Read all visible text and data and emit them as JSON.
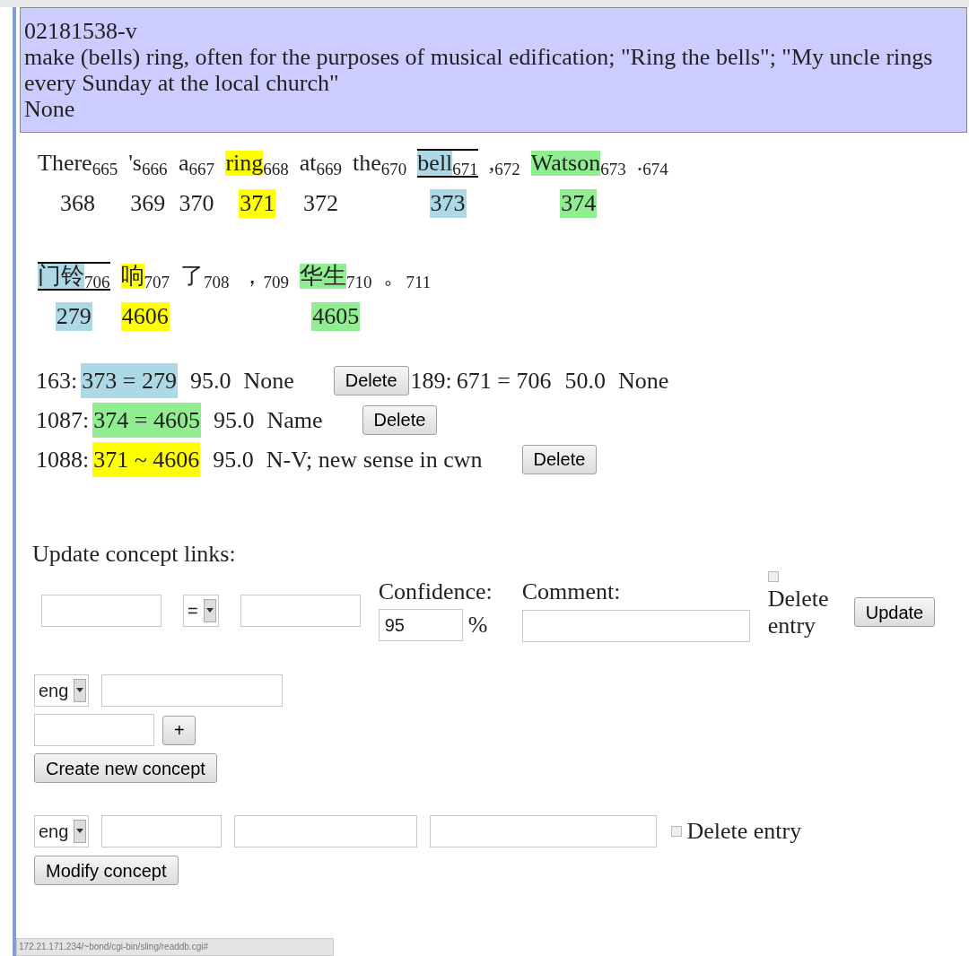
{
  "header": {
    "id": "02181538-v",
    "definition": "make (bells) ring, often for the purposes of musical edification; \"Ring the bells\"; \"My uncle rings every Sunday at the local church\"",
    "note": "None"
  },
  "sentences": [
    {
      "tokens": [
        {
          "text": "There",
          "index": "665",
          "concept": "368",
          "framed": false
        },
        {
          "text": "'s",
          "index": "666",
          "concept": "369",
          "framed": false
        },
        {
          "text": "a",
          "index": "667",
          "concept": "370",
          "framed": false
        },
        {
          "text": "ring",
          "index": "668",
          "concept": "371",
          "color": "#ffff00",
          "framed": false
        },
        {
          "text": "at",
          "index": "669",
          "concept": "372",
          "framed": false
        },
        {
          "text": "the",
          "index": "670",
          "framed": false
        },
        {
          "text": "bell",
          "index": "671",
          "concept": "373",
          "color": "#add8e6",
          "framed": true
        },
        {
          "text": ",",
          "index": "672",
          "framed": false
        },
        {
          "text": "Watson",
          "index": "673",
          "concept": "374",
          "color": "#90ee90",
          "framed": false
        },
        {
          "text": ".",
          "index": "674",
          "framed": false
        }
      ]
    },
    {
      "tokens": [
        {
          "text": "门铃",
          "index": "706",
          "concept": "279",
          "color": "#add8e6",
          "framed": true
        },
        {
          "text": "响",
          "index": "707",
          "concept": "4606",
          "color": "#ffff00",
          "framed": false
        },
        {
          "text": "了",
          "index": "708",
          "framed": false
        },
        {
          "text": "，",
          "index": "709",
          "framed": false
        },
        {
          "text": "华生",
          "index": "710",
          "concept": "4605",
          "color": "#90ee90",
          "framed": false
        },
        {
          "text": "。",
          "index": "711",
          "framed": false
        }
      ]
    }
  ],
  "links": [
    {
      "kind": "row",
      "id": "163:",
      "link": "373 = 279",
      "color": "#add8e6",
      "confidence": "95.0",
      "comment": "None",
      "button": "Delete"
    },
    {
      "kind": "inline",
      "id": "189:",
      "link": "671 = 706",
      "confidence": "50.0",
      "comment": "None"
    },
    {
      "kind": "row",
      "id": "1087:",
      "link": "374 = 4605",
      "color": "#90ee90",
      "confidence": "95.0",
      "comment": "Name",
      "button": "Delete"
    },
    {
      "kind": "row",
      "id": "1088:",
      "link": "371 ~ 4606",
      "color": "#ffff00",
      "confidence": "95.0",
      "comment": "N-V; new sense in cwn",
      "button": "Delete"
    }
  ],
  "update_form": {
    "title": "Update concept links:",
    "operator": "=",
    "confidence_label": "Confidence:",
    "confidence_value": "95",
    "percent": "%",
    "comment_label": "Comment:",
    "delete_label": "Delete entry",
    "delete_checked": false,
    "button": "Update"
  },
  "create_form": {
    "language": "eng",
    "add_button": "+",
    "button": "Create new concept"
  },
  "modify_form": {
    "language": "eng",
    "delete_label": "Delete entry",
    "delete_checked": false,
    "button": "Modify concept"
  },
  "status_bar": {
    "url": "172.21.171.234/~bond/cgi-bin/sling/readdb.cgi#"
  }
}
